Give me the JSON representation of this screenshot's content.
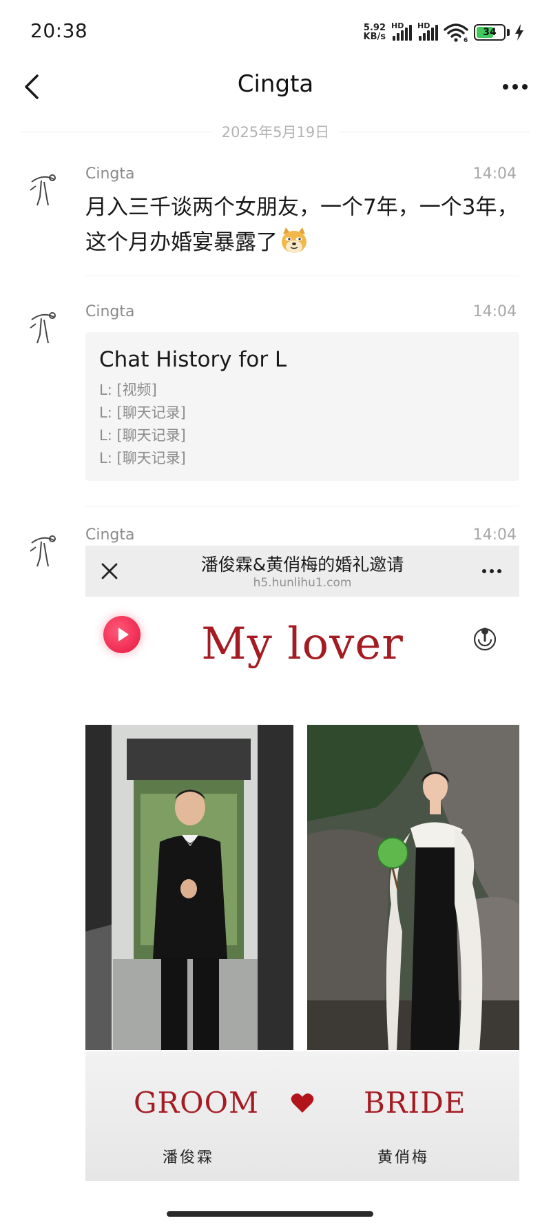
{
  "status_bar": {
    "time": "20:38",
    "net_speed_value": "5.92",
    "net_speed_unit": "KB/s",
    "sim1_label": "HD",
    "sim2_label": "HD",
    "wifi_label": "6",
    "battery_percent": "34",
    "charging": true
  },
  "header": {
    "title": "Cingta",
    "back_icon": "chevron-left-icon",
    "more_icon": "more-horizontal-icon"
  },
  "date_divider": "2025年5月19日",
  "messages": [
    {
      "sender": "Cingta",
      "time": "14:04",
      "text": "月入三千谈两个女朋友，一个7年，一个3年，这个月办婚宴暴露了",
      "emoji": "doge-emoji"
    },
    {
      "sender": "Cingta",
      "time": "14:04",
      "card": {
        "title": "Chat History for L",
        "lines": [
          "L: [视频]",
          "L: [聊天记录]",
          "L: [聊天记录]",
          "L: [聊天记录]"
        ]
      }
    },
    {
      "sender": "Cingta",
      "time": "14:04",
      "web": {
        "title": "潘俊霖&黄俏梅的婚礼邀请",
        "url": "h5.hunlihu1.com",
        "headline": "My lover",
        "groom_label": "GROOM",
        "bride_label": "BRIDE",
        "groom_name": "潘俊霖",
        "bride_name": "黄俏梅"
      }
    }
  ],
  "colors": {
    "accent_red": "#a41b22",
    "music_button": "#e8163f",
    "card_background": "#f5f5f5",
    "battery_green": "#42c95d"
  }
}
